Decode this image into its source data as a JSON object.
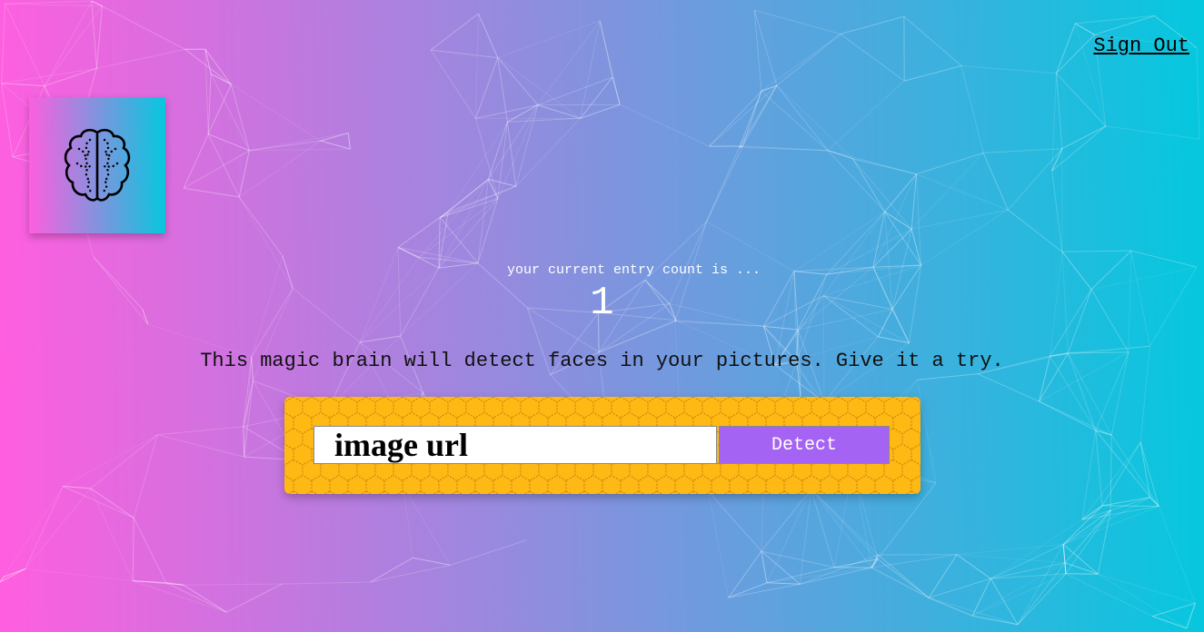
{
  "nav": {
    "sign_out_label": "Sign Out"
  },
  "logo": {
    "icon": "brain-icon"
  },
  "rank": {
    "label": "your current entry count is ...",
    "count": "1"
  },
  "intro": {
    "text": "This magic brain will detect faces in your pictures. Give it a try."
  },
  "form": {
    "input_value": "",
    "input_placeholder": "image url",
    "button_label": "Detect"
  },
  "colors": {
    "gradient_start": "#ff5edf",
    "gradient_end": "#04c8de",
    "panel": "#ffb914",
    "button": "#a463f2"
  }
}
